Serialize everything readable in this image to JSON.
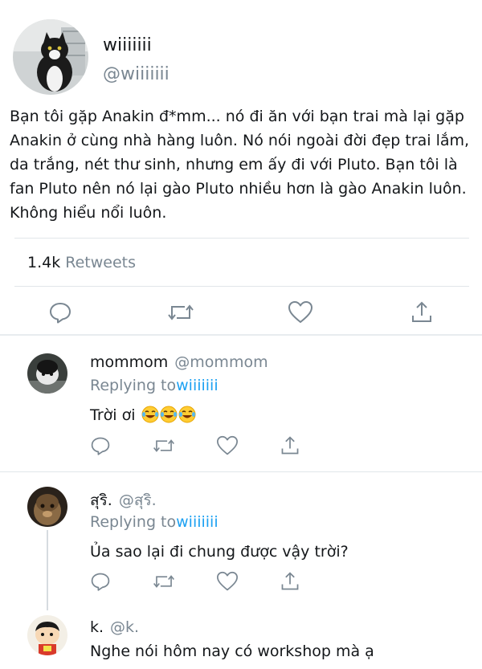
{
  "main_tweet": {
    "display_name": "wiiiiiii",
    "handle": "@wiiiiiii",
    "text": "Bạn tôi gặp Anakin đ*mm... nó đi ăn với bạn trai mà lại gặp Anakin ở cùng nhà hàng luôn. Nó nói ngoài đời đẹp trai lắm, da trắng, nét thư sinh, nhưng em ấy đi với Pluto. Bạn tôi là fan Pluto nên nó lại gào Pluto nhiều hơn là gào Anakin luôn. Không hiểu nổi luôn.",
    "retweet_count": "1.4k",
    "retweet_label": "Retweets",
    "actions": [
      "reply-icon",
      "retweet-icon",
      "like-icon",
      "share-icon"
    ]
  },
  "replies": [
    {
      "display_name": "mommom",
      "handle": "@mommom",
      "replying_prefix": "Replying to",
      "replying_to": "wiiiiiii",
      "text": "Trời ơi",
      "emoji_count": 3
    },
    {
      "display_name": "สุริ.",
      "handle": "@สุริ.",
      "replying_prefix": "Replying to",
      "replying_to": "wiiiiiii",
      "text": "Ủa sao lại đi chung được vậy trời?"
    },
    {
      "display_name": "k.",
      "handle": "@k.",
      "text": "Nghe nói hôm nay có workshop mà ạ"
    }
  ],
  "colors": {
    "text": "#14171a",
    "muted": "#7a8792",
    "link": "#1da1f2",
    "divider": "#e1e6ea",
    "icon": "#7a8792"
  }
}
